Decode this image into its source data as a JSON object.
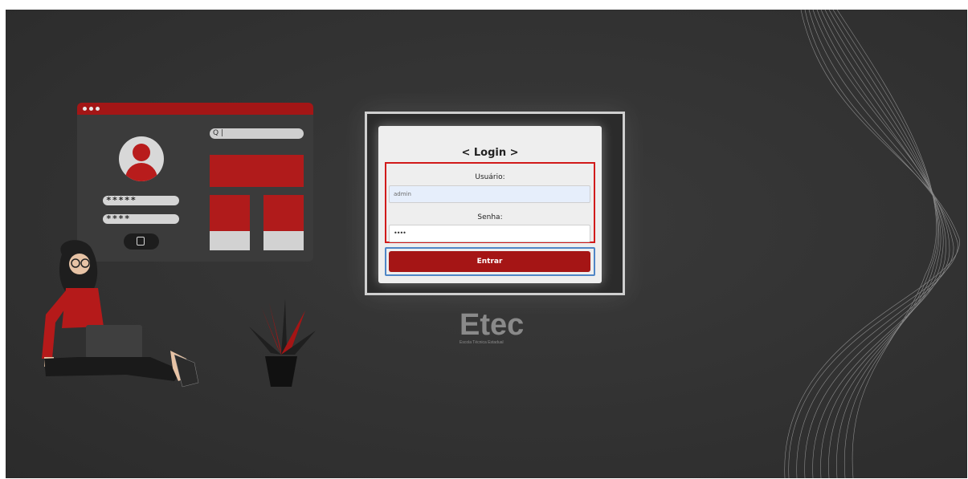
{
  "illustration": {
    "search_text": "Q |",
    "user_mask": "*****",
    "pass_mask": "****"
  },
  "login": {
    "title": "< Login >",
    "username_label": "Usuário:",
    "username_value": "admin",
    "password_label": "Senha:",
    "password_value": "••••",
    "submit_label": "Entrar"
  },
  "brand": {
    "logo_text": "Etec",
    "logo_subtitle": "Escola Técnica Estadual"
  },
  "colors": {
    "background": "#333333",
    "accent": "#a51515",
    "highlight_red": "#d11a1a",
    "highlight_blue": "#4f86c6"
  }
}
